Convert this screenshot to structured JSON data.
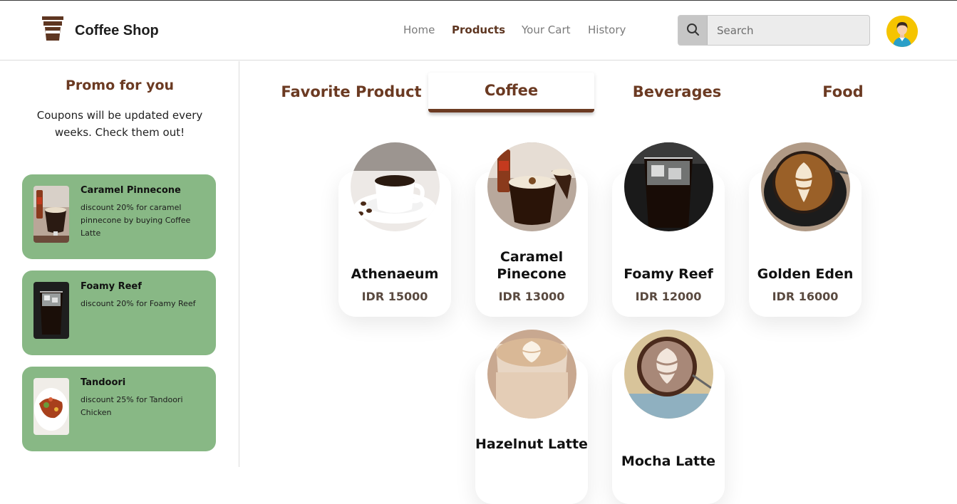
{
  "brand": {
    "name": "Coffee Shop",
    "logo_icon": "coffee-cup-icon"
  },
  "nav": [
    {
      "label": "Home",
      "active": false
    },
    {
      "label": "Products",
      "active": true
    },
    {
      "label": "Your Cart",
      "active": false
    },
    {
      "label": "History",
      "active": false
    }
  ],
  "search": {
    "placeholder": "Search",
    "value": "",
    "icon": "search-icon"
  },
  "user": {
    "avatar_icon": "user-avatar-icon"
  },
  "promo": {
    "title": "Promo for you",
    "subtitle": "Coupons will be updated every weeks. Check them out!",
    "coupons": [
      {
        "title": "Caramel Pinnecone",
        "description": "discount 20% for caramel pinnecone by buying Coffee Latte"
      },
      {
        "title": "Foamy Reef",
        "description": "discount 20% for Foamy Reef"
      },
      {
        "title": "Tandoori",
        "description": "discount 25% for Tandoori Chicken"
      }
    ]
  },
  "tabs": [
    {
      "label": "Favorite Product",
      "active": false
    },
    {
      "label": "Coffee",
      "active": true
    },
    {
      "label": "Beverages",
      "active": false
    },
    {
      "label": "Food",
      "active": false
    }
  ],
  "products": [
    {
      "name": "Athenaeum",
      "price": "IDR 15000"
    },
    {
      "name": "Caramel Pinecone",
      "price": "IDR 13000"
    },
    {
      "name": "Foamy Reef",
      "price": "IDR 12000"
    },
    {
      "name": "Golden Eden",
      "price": "IDR 16000"
    },
    {
      "name": "Hazelnut Latte",
      "price": ""
    },
    {
      "name": "Mocha Latte",
      "price": ""
    }
  ],
  "colors": {
    "accent": "#6b3a22",
    "coupon_bg": "#88b885",
    "avatar_bg": "#f5c400"
  }
}
